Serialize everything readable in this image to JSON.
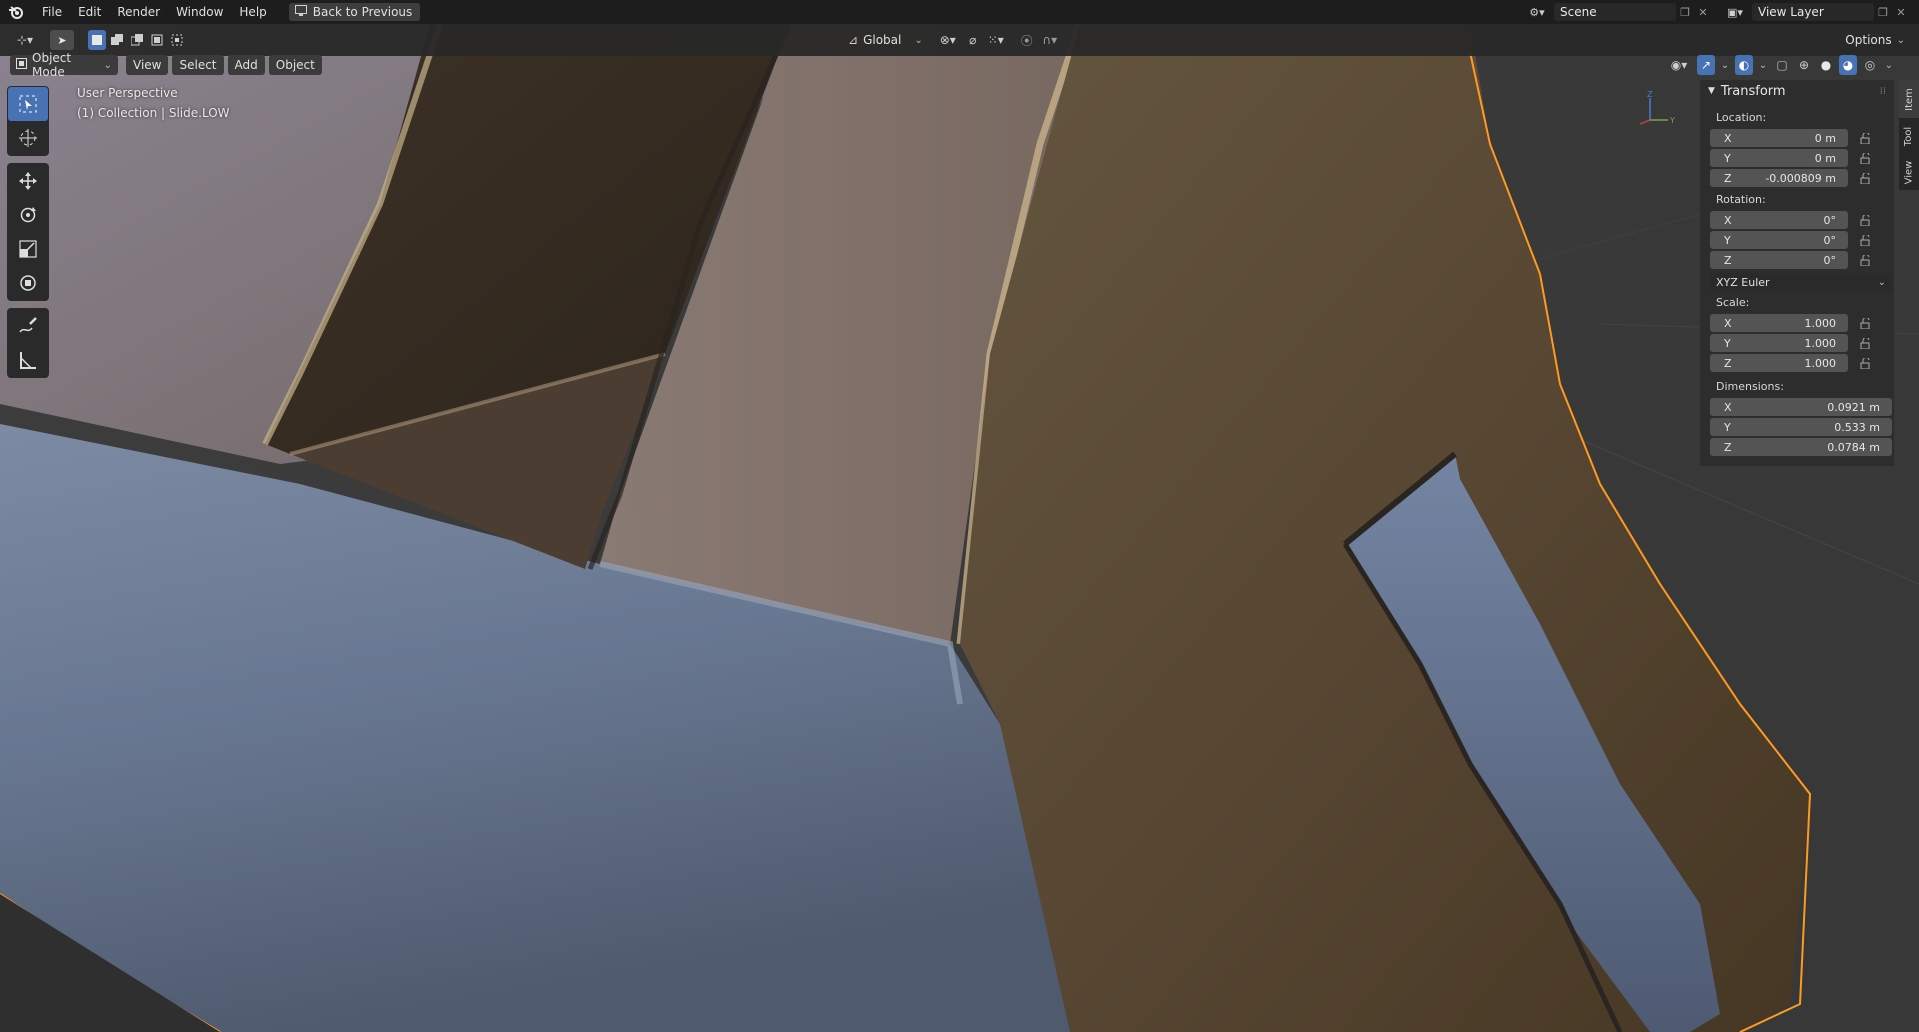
{
  "menu": {
    "items": [
      "File",
      "Edit",
      "Render",
      "Window",
      "Help"
    ],
    "back_button": "Back to Previous"
  },
  "scene": {
    "label": "Scene",
    "view_layer": "View Layer"
  },
  "header": {
    "transform_orientation": "Global",
    "options": "Options",
    "mode": "Object Mode",
    "view": "View",
    "select": "Select",
    "add": "Add",
    "object": "Object"
  },
  "overlay": {
    "perspective": "User Perspective",
    "collection": "(1) Collection | Slide.LOW"
  },
  "transform": {
    "title": "Transform",
    "location_label": "Location:",
    "location": [
      {
        "axis": "X",
        "value": "0 m"
      },
      {
        "axis": "Y",
        "value": "0 m"
      },
      {
        "axis": "Z",
        "value": "-0.000809 m"
      }
    ],
    "rotation_label": "Rotation:",
    "rotation": [
      {
        "axis": "X",
        "value": "0°"
      },
      {
        "axis": "Y",
        "value": "0°"
      },
      {
        "axis": "Z",
        "value": "0°"
      }
    ],
    "rotation_mode": "XYZ Euler",
    "scale_label": "Scale:",
    "scale": [
      {
        "axis": "X",
        "value": "1.000"
      },
      {
        "axis": "Y",
        "value": "1.000"
      },
      {
        "axis": "Z",
        "value": "1.000"
      }
    ],
    "dimensions_label": "Dimensions:",
    "dimensions": [
      {
        "axis": "X",
        "value": "0.0921 m"
      },
      {
        "axis": "Y",
        "value": "0.533 m"
      },
      {
        "axis": "Z",
        "value": "0.0784 m"
      }
    ]
  },
  "side_tabs": [
    "Item",
    "Tool",
    "View"
  ],
  "gizmo": {
    "z_label": "Z",
    "y_label": "Y"
  },
  "colors": {
    "accent": "#4772b3",
    "selection_outline": "#ff9a1f",
    "panel": "#2d2d2d"
  }
}
